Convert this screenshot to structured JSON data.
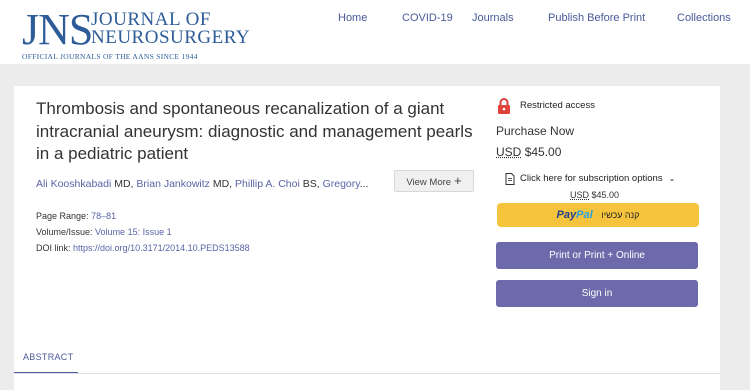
{
  "logo": {
    "acronym": "JNS",
    "line1": "JOURNAL OF",
    "line2": "NEUROSURGERY",
    "tagline": "OFFICIAL JOURNALS OF THE AANS SINCE 1944"
  },
  "nav": {
    "home": "Home",
    "covid": "COVID-19",
    "journals": "Journals",
    "publish": "Publish Before Print",
    "collections": "Collections"
  },
  "article": {
    "title": "Thrombosis and spontaneous recanalization of a giant intracranial aneurysm: diagnostic and management pearls in a pediatric patient",
    "authors": [
      {
        "name": "Ali Kooshkabadi",
        "degree": " MD, "
      },
      {
        "name": "Brian Jankowitz",
        "degree": " MD, "
      },
      {
        "name": "Phillip A. Choi",
        "degree": " BS, "
      },
      {
        "name": "Gregory",
        "degree": "..."
      }
    ],
    "view_more": "View More",
    "view_more_icon": "plus-icon",
    "page_range_label": "Page Range:",
    "page_range": "78–81",
    "volume_label": "Volume/Issue:",
    "volume": "Volume 15: Issue 1",
    "doi_label": "DOI link:",
    "doi": "https://doi.org/10.3171/2014.10.PEDS13588"
  },
  "tabs": {
    "abstract": "ABSTRACT"
  },
  "access": {
    "lock_icon": "lock-icon",
    "lock_color": "#e0413a",
    "restricted": "Restricted access",
    "purchase": "Purchase Now",
    "currency": "USD",
    "price": "$45.00",
    "subscription": "Click here for subscription options",
    "doc_icon": "document-icon",
    "chevron_icon": "chevron-down-icon",
    "sub_currency": "USD",
    "sub_price": "$45.00",
    "paypal_part1": "Pay",
    "paypal_part2": "Pal",
    "paypal_hebrew": "קנה עכשיו",
    "paypal_color": "#f6c43c",
    "print_button": "Print or Print + Online",
    "signin_button": "Sign in",
    "button_color": "#6d6aab"
  }
}
